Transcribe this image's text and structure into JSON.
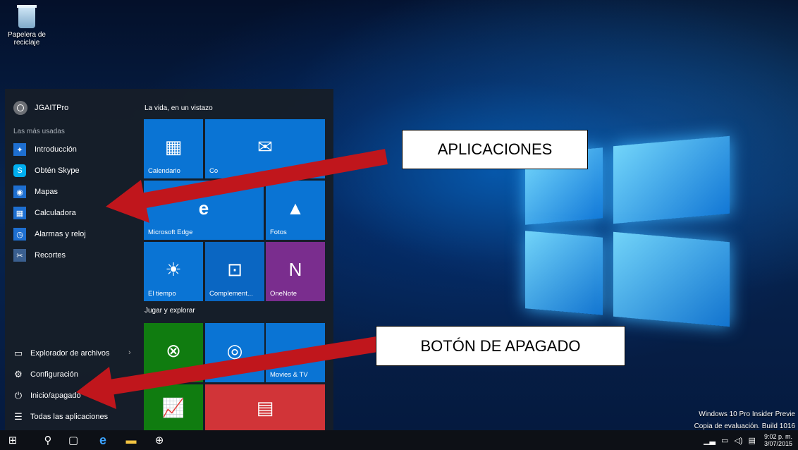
{
  "desktop": {
    "recycle_bin_label": "Papelera de reciclaje",
    "watermark_line1": "Windows 10 Pro Insider Previe",
    "watermark_line2": "Copia de evaluación. Build 1016"
  },
  "start_menu": {
    "user_name": "JGAITPro",
    "most_used_label": "Las más usadas",
    "apps": [
      {
        "label": "Introducción",
        "icon": "lightbulb-icon"
      },
      {
        "label": "Obtén Skype",
        "icon": "skype-icon"
      },
      {
        "label": "Mapas",
        "icon": "maps-icon"
      },
      {
        "label": "Calculadora",
        "icon": "calculator-icon"
      },
      {
        "label": "Alarmas y reloj",
        "icon": "alarm-clock-icon"
      },
      {
        "label": "Recortes",
        "icon": "snipping-icon"
      }
    ],
    "bottom": {
      "explorer": "Explorador de archivos",
      "settings": "Configuración",
      "power": "Inicio/apagado",
      "all_apps": "Todas las aplicaciones"
    },
    "group1_title": "La vida, en un vistazo",
    "group2_title": "Jugar y explorar",
    "tiles": {
      "calendar": "Calendario",
      "mail": "Co",
      "edge": "Microsoft Edge",
      "photos": "Fotos",
      "weather": "El tiempo",
      "complement": "Complement...",
      "onenote": "OneNote",
      "movies": "Movies & TV"
    }
  },
  "callouts": {
    "apps": "APLICACIONES",
    "power": "BOTÓN DE APAGADO"
  },
  "taskbar": {
    "time": "9:02 p. m.",
    "date": "3/07/2015"
  },
  "colors": {
    "tile_blue": "#0a74d4",
    "tile_green": "#107c10",
    "tile_purple": "#7a2d8e",
    "tile_red": "#d13438",
    "arrow_red": "#c0161c"
  }
}
